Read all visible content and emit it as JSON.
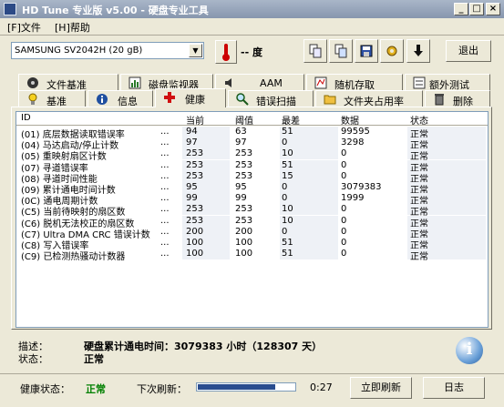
{
  "window": {
    "title": "HD Tune 专业版 v5.00 - 硬盘专业工具",
    "controls": [
      "_",
      "□",
      "×"
    ]
  },
  "menu": {
    "file": "[F]文件",
    "help": "[H]帮助"
  },
  "toolbar": {
    "drive": "SAMSUNG SV2042H (20 gB)",
    "temperature": "-- 度",
    "exit": "退出",
    "buttons": [
      "copy-info",
      "copy-screen",
      "save",
      "options",
      "download"
    ]
  },
  "tabs": {
    "row1": [
      "文件基准",
      "磁盘监视器",
      "AAM",
      "随机存取",
      "额外测试"
    ],
    "row2": [
      "基准",
      "信息",
      "健康",
      "错误扫描",
      "文件夹占用率",
      "删除"
    ]
  },
  "table": {
    "headers": {
      "id": "ID",
      "current": "当前",
      "threshold": "阈值",
      "worst": "最差",
      "data": "数据",
      "status": "状态"
    },
    "rows": [
      {
        "id": "(01) 底层数据读取错误率",
        "current": "94",
        "threshold": "63",
        "worst": "51",
        "data": "99595",
        "status": "正常"
      },
      {
        "id": "(04) 马达启动/停止计数",
        "current": "97",
        "threshold": "97",
        "worst": "0",
        "data": "3298",
        "status": "正常"
      },
      {
        "id": "(05) 重映射扇区计数",
        "current": "253",
        "threshold": "253",
        "worst": "10",
        "data": "0",
        "status": "正常"
      },
      {
        "id": "(07) 寻道错误率",
        "current": "253",
        "threshold": "253",
        "worst": "51",
        "data": "0",
        "status": "正常"
      },
      {
        "id": "(08) 寻道时间性能",
        "current": "253",
        "threshold": "253",
        "worst": "15",
        "data": "0",
        "status": "正常"
      },
      {
        "id": "(09) 累计通电时间计数",
        "current": "95",
        "threshold": "95",
        "worst": "0",
        "data": "3079383",
        "status": "正常"
      },
      {
        "id": "(0C) 通电周期计数",
        "current": "99",
        "threshold": "99",
        "worst": "0",
        "data": "1999",
        "status": "正常"
      },
      {
        "id": "(C5) 当前待映射的扇区数",
        "current": "253",
        "threshold": "253",
        "worst": "10",
        "data": "0",
        "status": "正常"
      },
      {
        "id": "(C6) 脱机无法校正的扇区数",
        "current": "253",
        "threshold": "253",
        "worst": "10",
        "data": "0",
        "status": "正常"
      },
      {
        "id": "(C7) Ultra DMA CRC 错误计数",
        "current": "200",
        "threshold": "200",
        "worst": "0",
        "data": "0",
        "status": "正常"
      },
      {
        "id": "(C8) 写入错误率",
        "current": "100",
        "threshold": "100",
        "worst": "51",
        "data": "0",
        "status": "正常"
      },
      {
        "id": "(C9) 已检测热骚动计数器",
        "current": "100",
        "threshold": "100",
        "worst": "51",
        "data": "0",
        "status": "正常"
      }
    ],
    "ellipsis": "..."
  },
  "details": {
    "desc_label": "描述：",
    "desc_value": "硬盘累计通电时间：3079383 小时（128307 天）",
    "status_label": "状态：",
    "status_value": "正常"
  },
  "statusbar": {
    "health_label": "健康状态：",
    "health_value": "正常",
    "health_color": "#008000",
    "next_label": "下次刷新：",
    "progress_fraction": 0.8,
    "countdown": "0:27",
    "refresh": "立即刷新",
    "log": "日志"
  }
}
